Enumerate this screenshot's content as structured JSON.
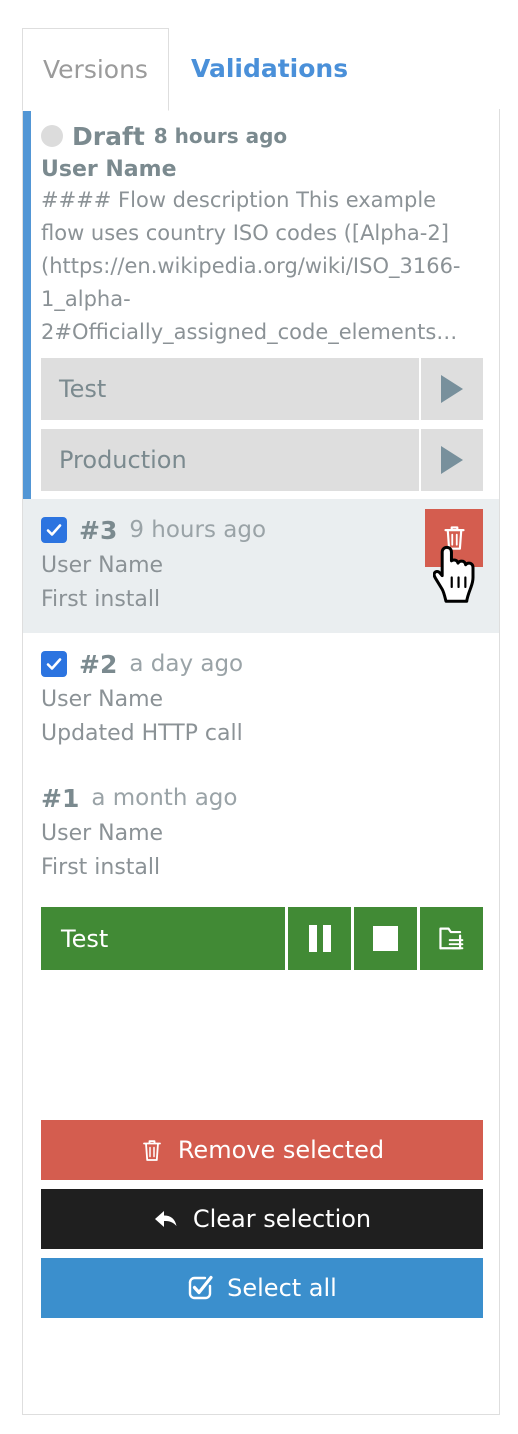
{
  "tabs": [
    {
      "label": "Versions",
      "active": true
    },
    {
      "label": "Validations",
      "active": false
    }
  ],
  "draft": {
    "status_label": "Draft",
    "time": "8 hours ago",
    "user": "User Name",
    "description": "#### Flow description This example flow uses country ISO codes ([Alpha-2] (https://en.wikipedia.org/wiki/ISO_3166-1_alpha-2#Officially_assigned_code_elements…",
    "environments": [
      {
        "label": "Test",
        "action_icon": "play-icon"
      },
      {
        "label": "Production",
        "action_icon": "play-icon"
      }
    ]
  },
  "versions": [
    {
      "number": "#3",
      "time": "9 hours ago",
      "user": "User Name",
      "message": "First install",
      "checked": true,
      "highlighted": true,
      "delete_icon": "trash-icon"
    },
    {
      "number": "#2",
      "time": "a day ago",
      "user": "User Name",
      "message": "Updated HTTP call",
      "checked": true,
      "highlighted": false
    },
    {
      "number": "#1",
      "time": "a month ago",
      "user": "User Name",
      "message": "First install",
      "checked": false,
      "highlighted": false
    }
  ],
  "run_bar": {
    "label": "Test",
    "buttons": [
      "pause-icon",
      "stop-icon",
      "logs-folder-icon"
    ]
  },
  "actions": [
    {
      "label": "Remove selected",
      "icon": "trash-icon",
      "color": "#d45d4f"
    },
    {
      "label": "Clear selection",
      "icon": "arrow-back-icon",
      "color": "#1f1f1f"
    },
    {
      "label": "Select all",
      "icon": "check-square-icon",
      "color": "#3b8fcd"
    }
  ],
  "colors": {
    "accent_blue": "#5296d5",
    "tab_active_text": "#9b9b9b",
    "tab_inactive_text": "#4a90d9",
    "checkbox_blue": "#2c74e0",
    "danger_red": "#d45d4f",
    "run_green": "#418a35",
    "row_highlight": "#eaeef0",
    "env_gray": "#dedede",
    "play_gray": "#78909c"
  },
  "cursor": {
    "type": "pointing-hand"
  }
}
